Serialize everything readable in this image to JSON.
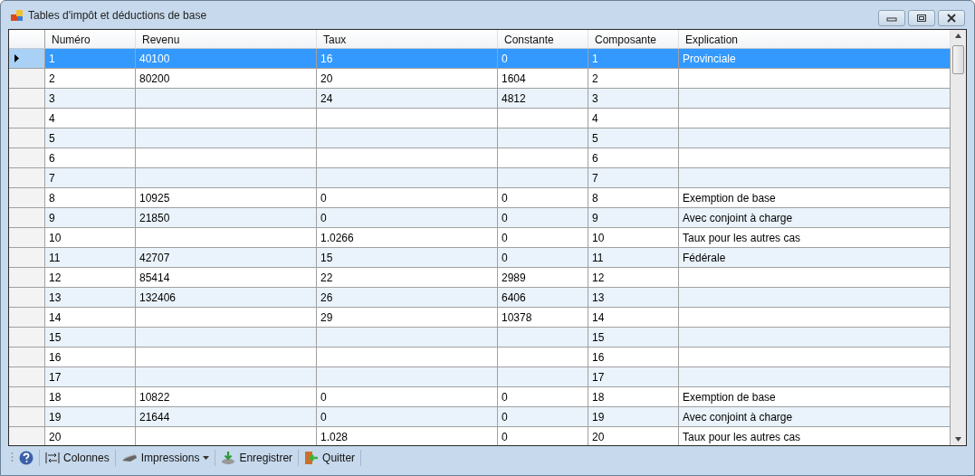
{
  "window": {
    "title": "Tables d'impôt et déductions de base"
  },
  "table": {
    "columns": [
      "Numéro",
      "Revenu",
      "Taux",
      "Constante",
      "Composante",
      "Explication"
    ],
    "rows": [
      {
        "selected": true,
        "cells": [
          "1",
          "40100",
          "16",
          "0",
          "1",
          "Provinciale"
        ]
      },
      {
        "selected": false,
        "cells": [
          "2",
          "80200",
          "20",
          "1604",
          "2",
          ""
        ]
      },
      {
        "selected": false,
        "cells": [
          "3",
          "",
          "24",
          "4812",
          "3",
          ""
        ]
      },
      {
        "selected": false,
        "cells": [
          "4",
          "",
          "",
          "",
          "4",
          ""
        ]
      },
      {
        "selected": false,
        "cells": [
          "5",
          "",
          "",
          "",
          "5",
          ""
        ]
      },
      {
        "selected": false,
        "cells": [
          "6",
          "",
          "",
          "",
          "6",
          ""
        ]
      },
      {
        "selected": false,
        "cells": [
          "7",
          "",
          "",
          "",
          "7",
          ""
        ]
      },
      {
        "selected": false,
        "cells": [
          "8",
          "10925",
          "0",
          "0",
          "8",
          "Exemption de base"
        ]
      },
      {
        "selected": false,
        "cells": [
          "9",
          "21850",
          "0",
          "0",
          "9",
          "Avec conjoint à charge"
        ]
      },
      {
        "selected": false,
        "cells": [
          "10",
          "",
          "1.0266",
          "0",
          "10",
          "Taux pour les autres cas"
        ]
      },
      {
        "selected": false,
        "cells": [
          "11",
          "42707",
          "15",
          "0",
          "11",
          "Fédérale"
        ]
      },
      {
        "selected": false,
        "cells": [
          "12",
          "85414",
          "22",
          "2989",
          "12",
          ""
        ]
      },
      {
        "selected": false,
        "cells": [
          "13",
          "132406",
          "26",
          "6406",
          "13",
          ""
        ]
      },
      {
        "selected": false,
        "cells": [
          "14",
          "",
          "29",
          "10378",
          "14",
          ""
        ]
      },
      {
        "selected": false,
        "cells": [
          "15",
          "",
          "",
          "",
          "15",
          ""
        ]
      },
      {
        "selected": false,
        "cells": [
          "16",
          "",
          "",
          "",
          "16",
          ""
        ]
      },
      {
        "selected": false,
        "cells": [
          "17",
          "",
          "",
          "",
          "17",
          ""
        ]
      },
      {
        "selected": false,
        "cells": [
          "18",
          "10822",
          "0",
          "0",
          "18",
          "Exemption de base"
        ]
      },
      {
        "selected": false,
        "cells": [
          "19",
          "21644",
          "0",
          "0",
          "19",
          "Avec conjoint à charge"
        ]
      },
      {
        "selected": false,
        "cells": [
          "20",
          "",
          "1.028",
          "0",
          "20",
          "Taux pour les autres cas"
        ]
      }
    ]
  },
  "toolbar": [
    {
      "kind": "help"
    },
    {
      "kind": "columns",
      "label": "Colonnes"
    },
    {
      "kind": "print",
      "label": "Impressions"
    },
    {
      "kind": "save",
      "label": "Enregistrer"
    },
    {
      "kind": "quit",
      "label": "Quitter"
    }
  ]
}
